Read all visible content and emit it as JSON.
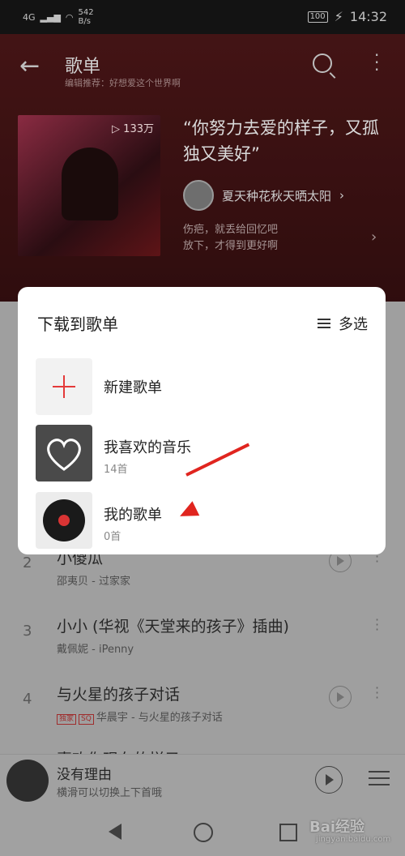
{
  "status_bar": {
    "network": "4G",
    "speed_value": "542",
    "speed_unit": "B/s",
    "battery": "100",
    "time": "14:32"
  },
  "nav": {
    "title": "歌单",
    "subtitle": "编辑推荐：好想爱这个世界啊"
  },
  "playlist": {
    "play_count": "133万",
    "quote": "“你努力去爱的样子，又孤独又美好”",
    "creator": "夏天种花秋天晒太阳",
    "desc_line1": "伤疤，就丢给回忆吧",
    "desc_line2": "放下，才得到更好啊"
  },
  "dialog": {
    "title": "下载到歌单",
    "multi_select": "多选",
    "items": [
      {
        "label": "新建歌单",
        "count": ""
      },
      {
        "label": "我喜欢的音乐",
        "count": "14首"
      },
      {
        "label": "我的歌单",
        "count": "0首"
      }
    ]
  },
  "songs": [
    {
      "num": "2",
      "title": "小傻瓜",
      "sub": "邵夷贝 - 过家家",
      "tags": []
    },
    {
      "num": "3",
      "title": "小小 (华视《天堂来的孩子》插曲)",
      "sub": "戴佩妮 - iPenny",
      "tags": []
    },
    {
      "num": "4",
      "title": "与火星的孩子对话",
      "sub": "华晨宇 - 与火星的孩子对话",
      "tags": [
        "独家",
        "SQ"
      ]
    },
    {
      "num": "",
      "title": "喜欢你现在的样子",
      "sub": "",
      "tags": []
    }
  ],
  "mini_player": {
    "title": "没有理由",
    "subtitle": "横滑可以切换上下首哦"
  },
  "watermark": {
    "brand": "Bai经验",
    "url": "jingyan.baidu.com"
  },
  "colors": {
    "accent": "#e43a3a",
    "header_bg": "#4a1416",
    "arrow": "#e0251f"
  }
}
